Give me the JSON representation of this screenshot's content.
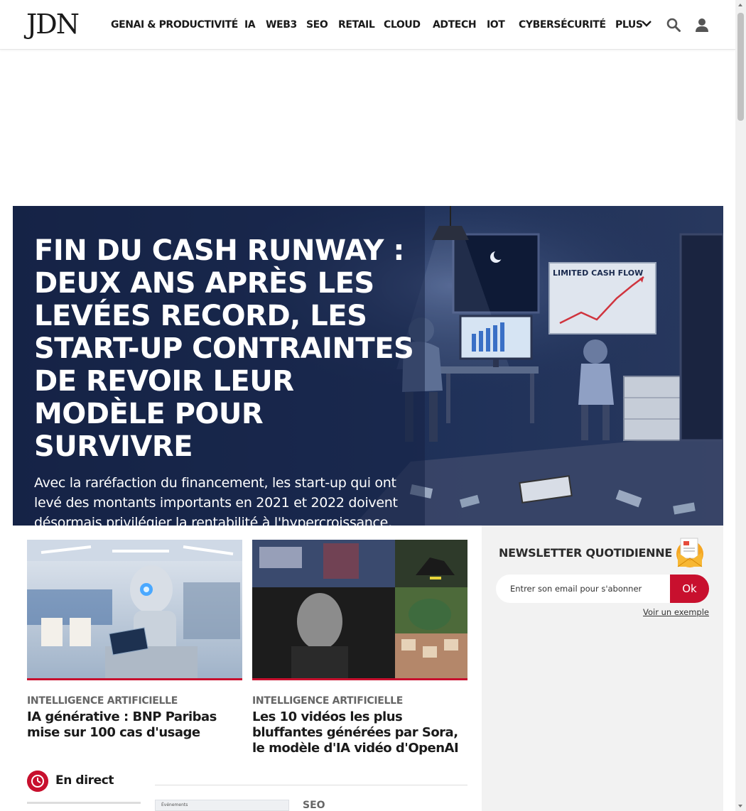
{
  "header": {
    "logo": "JDN",
    "nav": [
      "GENAI & PRODUCTIVITÉ",
      "IA",
      "WEB3",
      "SEO",
      "RETAIL",
      "CLOUD",
      "ADTECH",
      "IOT",
      "CYBERSÉCURITÉ"
    ],
    "more_label": "PLUS",
    "icons": [
      "chevron-down-icon",
      "search-icon",
      "user-icon"
    ]
  },
  "hero": {
    "title": "Fin du cash runway : deux ans après les levées record, les start-up contraintes de revoir leur modèle pour survivre",
    "description": "Avec la raréfaction du financement, les start-up qui ont levé des montants importants en 2021 et 2022 doivent désormais privilégier la rentabilité à l'hypercroissance.",
    "illustration": {
      "board_title": "LIMITED CASH FLOW"
    }
  },
  "articles": [
    {
      "category": "INTELLIGENCE ARTIFICIELLE",
      "title": "IA générative : BNP Paribas mise sur 100 cas d'usage"
    },
    {
      "category": "INTELLIGENCE ARTIFICIELLE",
      "title": "Les 10 vidéos les plus bluffantes générées par Sora, le modèle d'IA vidéo d'OpenAI"
    }
  ],
  "live": {
    "label": "En direct"
  },
  "next_article": {
    "category": "SEO",
    "thumb_text": "Événements"
  },
  "newsletter": {
    "title": "NEWSLETTER QUOTIDIENNE",
    "placeholder": "Entrer son email pour s'abonner",
    "button": "Ok",
    "example_link": "Voir un exemple"
  },
  "colors": {
    "accent": "#c8102e",
    "hero_bg": "#1a2a4e"
  }
}
